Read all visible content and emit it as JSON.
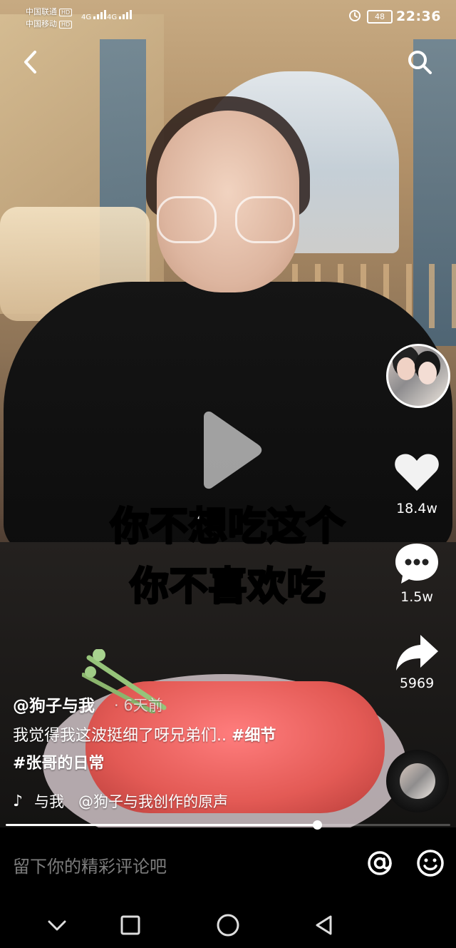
{
  "status": {
    "carrier_top": "中国联通",
    "carrier_bottom": "中国移动",
    "hd_label": "HD",
    "network1": "4G",
    "network2": "4G",
    "battery": "48",
    "time": "22:36"
  },
  "video": {
    "caption_line1": "你不想吃这个",
    "caption_line2": "你不喜欢吃",
    "progress_fraction": 0.7
  },
  "actions": {
    "like_count": "18.4w",
    "comment_count": "1.5w",
    "share_count": "5969"
  },
  "post": {
    "author": "@狗子与我",
    "time_ago": "· 6天前",
    "description": "我觉得我这波挺细了呀兄弟们.. ",
    "tag1": "#细节",
    "tag2": "#张哥的日常",
    "music_prefix": "与我",
    "music_text": "@狗子与我创作的原声"
  },
  "comment_bar": {
    "placeholder": "留下你的精彩评论吧"
  },
  "icons": {
    "back": "back-icon",
    "search": "search-icon",
    "play": "play-icon",
    "like": "heart-icon",
    "comment": "comment-icon",
    "share": "share-icon",
    "music": "music-note-icon",
    "at": "at-icon",
    "emoji": "emoji-icon"
  }
}
